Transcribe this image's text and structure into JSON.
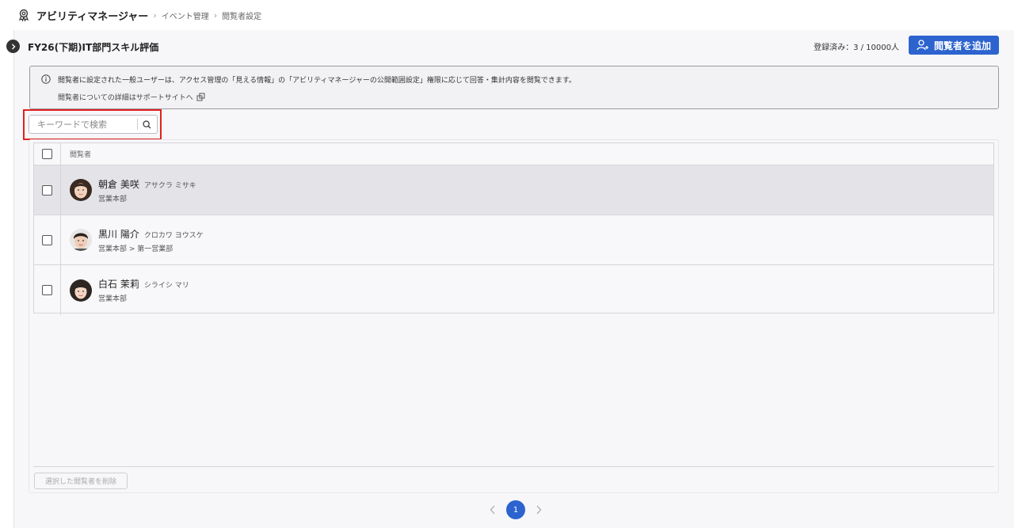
{
  "breadcrumb": {
    "app_name": "アビリティマネージャー",
    "items": [
      "イベント管理",
      "閲覧者設定"
    ]
  },
  "page": {
    "title": "FY26(下期)IT部門スキル評価",
    "registered_label": "登録済み：3 / 10000人",
    "add_button_label": "閲覧者を追加"
  },
  "info": {
    "line1": "閲覧者に設定された一般ユーザーは、アクセス管理の「見える情報」の「アビリティマネージャーの公開範囲設定」権限に応じて回答・集計内容を閲覧できます。",
    "link_label": "閲覧者についての詳細はサポートサイトへ"
  },
  "search": {
    "placeholder": "キーワードで検索",
    "value": ""
  },
  "table": {
    "header": "閲覧者",
    "rows": [
      {
        "name": "朝倉 美咲",
        "kana": "アサクラ ミサキ",
        "dept": "営業本部"
      },
      {
        "name": "黒川 陽介",
        "kana": "クロカワ ヨウスケ",
        "dept": "営業本部 > 第一営業部"
      },
      {
        "name": "白石 茉莉",
        "kana": "シライシ マリ",
        "dept": "営業本部"
      }
    ]
  },
  "footer": {
    "delete_label": "選択した閲覧者を削除"
  },
  "pagination": {
    "current": "1"
  },
  "colors": {
    "primary": "#2c63cf",
    "highlight": "#e02020"
  }
}
